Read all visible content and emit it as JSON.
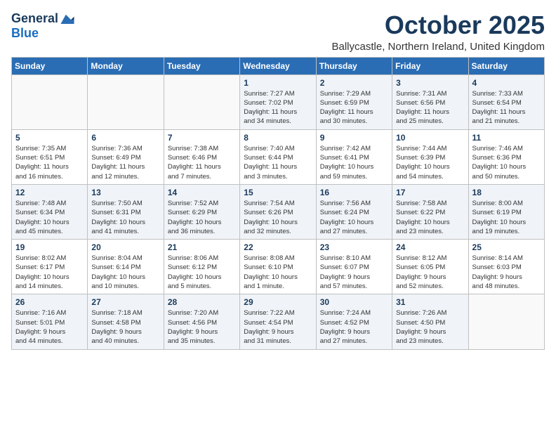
{
  "logo": {
    "line1": "General",
    "line2": "Blue"
  },
  "title": "October 2025",
  "subtitle": "Ballycastle, Northern Ireland, United Kingdom",
  "headers": [
    "Sunday",
    "Monday",
    "Tuesday",
    "Wednesday",
    "Thursday",
    "Friday",
    "Saturday"
  ],
  "weeks": [
    [
      {
        "day": "",
        "info": ""
      },
      {
        "day": "",
        "info": ""
      },
      {
        "day": "",
        "info": ""
      },
      {
        "day": "1",
        "info": "Sunrise: 7:27 AM\nSunset: 7:02 PM\nDaylight: 11 hours\nand 34 minutes."
      },
      {
        "day": "2",
        "info": "Sunrise: 7:29 AM\nSunset: 6:59 PM\nDaylight: 11 hours\nand 30 minutes."
      },
      {
        "day": "3",
        "info": "Sunrise: 7:31 AM\nSunset: 6:56 PM\nDaylight: 11 hours\nand 25 minutes."
      },
      {
        "day": "4",
        "info": "Sunrise: 7:33 AM\nSunset: 6:54 PM\nDaylight: 11 hours\nand 21 minutes."
      }
    ],
    [
      {
        "day": "5",
        "info": "Sunrise: 7:35 AM\nSunset: 6:51 PM\nDaylight: 11 hours\nand 16 minutes."
      },
      {
        "day": "6",
        "info": "Sunrise: 7:36 AM\nSunset: 6:49 PM\nDaylight: 11 hours\nand 12 minutes."
      },
      {
        "day": "7",
        "info": "Sunrise: 7:38 AM\nSunset: 6:46 PM\nDaylight: 11 hours\nand 7 minutes."
      },
      {
        "day": "8",
        "info": "Sunrise: 7:40 AM\nSunset: 6:44 PM\nDaylight: 11 hours\nand 3 minutes."
      },
      {
        "day": "9",
        "info": "Sunrise: 7:42 AM\nSunset: 6:41 PM\nDaylight: 10 hours\nand 59 minutes."
      },
      {
        "day": "10",
        "info": "Sunrise: 7:44 AM\nSunset: 6:39 PM\nDaylight: 10 hours\nand 54 minutes."
      },
      {
        "day": "11",
        "info": "Sunrise: 7:46 AM\nSunset: 6:36 PM\nDaylight: 10 hours\nand 50 minutes."
      }
    ],
    [
      {
        "day": "12",
        "info": "Sunrise: 7:48 AM\nSunset: 6:34 PM\nDaylight: 10 hours\nand 45 minutes."
      },
      {
        "day": "13",
        "info": "Sunrise: 7:50 AM\nSunset: 6:31 PM\nDaylight: 10 hours\nand 41 minutes."
      },
      {
        "day": "14",
        "info": "Sunrise: 7:52 AM\nSunset: 6:29 PM\nDaylight: 10 hours\nand 36 minutes."
      },
      {
        "day": "15",
        "info": "Sunrise: 7:54 AM\nSunset: 6:26 PM\nDaylight: 10 hours\nand 32 minutes."
      },
      {
        "day": "16",
        "info": "Sunrise: 7:56 AM\nSunset: 6:24 PM\nDaylight: 10 hours\nand 27 minutes."
      },
      {
        "day": "17",
        "info": "Sunrise: 7:58 AM\nSunset: 6:22 PM\nDaylight: 10 hours\nand 23 minutes."
      },
      {
        "day": "18",
        "info": "Sunrise: 8:00 AM\nSunset: 6:19 PM\nDaylight: 10 hours\nand 19 minutes."
      }
    ],
    [
      {
        "day": "19",
        "info": "Sunrise: 8:02 AM\nSunset: 6:17 PM\nDaylight: 10 hours\nand 14 minutes."
      },
      {
        "day": "20",
        "info": "Sunrise: 8:04 AM\nSunset: 6:14 PM\nDaylight: 10 hours\nand 10 minutes."
      },
      {
        "day": "21",
        "info": "Sunrise: 8:06 AM\nSunset: 6:12 PM\nDaylight: 10 hours\nand 5 minutes."
      },
      {
        "day": "22",
        "info": "Sunrise: 8:08 AM\nSunset: 6:10 PM\nDaylight: 10 hours\nand 1 minute."
      },
      {
        "day": "23",
        "info": "Sunrise: 8:10 AM\nSunset: 6:07 PM\nDaylight: 9 hours\nand 57 minutes."
      },
      {
        "day": "24",
        "info": "Sunrise: 8:12 AM\nSunset: 6:05 PM\nDaylight: 9 hours\nand 52 minutes."
      },
      {
        "day": "25",
        "info": "Sunrise: 8:14 AM\nSunset: 6:03 PM\nDaylight: 9 hours\nand 48 minutes."
      }
    ],
    [
      {
        "day": "26",
        "info": "Sunrise: 7:16 AM\nSunset: 5:01 PM\nDaylight: 9 hours\nand 44 minutes."
      },
      {
        "day": "27",
        "info": "Sunrise: 7:18 AM\nSunset: 4:58 PM\nDaylight: 9 hours\nand 40 minutes."
      },
      {
        "day": "28",
        "info": "Sunrise: 7:20 AM\nSunset: 4:56 PM\nDaylight: 9 hours\nand 35 minutes."
      },
      {
        "day": "29",
        "info": "Sunrise: 7:22 AM\nSunset: 4:54 PM\nDaylight: 9 hours\nand 31 minutes."
      },
      {
        "day": "30",
        "info": "Sunrise: 7:24 AM\nSunset: 4:52 PM\nDaylight: 9 hours\nand 27 minutes."
      },
      {
        "day": "31",
        "info": "Sunrise: 7:26 AM\nSunset: 4:50 PM\nDaylight: 9 hours\nand 23 minutes."
      },
      {
        "day": "",
        "info": ""
      }
    ]
  ]
}
